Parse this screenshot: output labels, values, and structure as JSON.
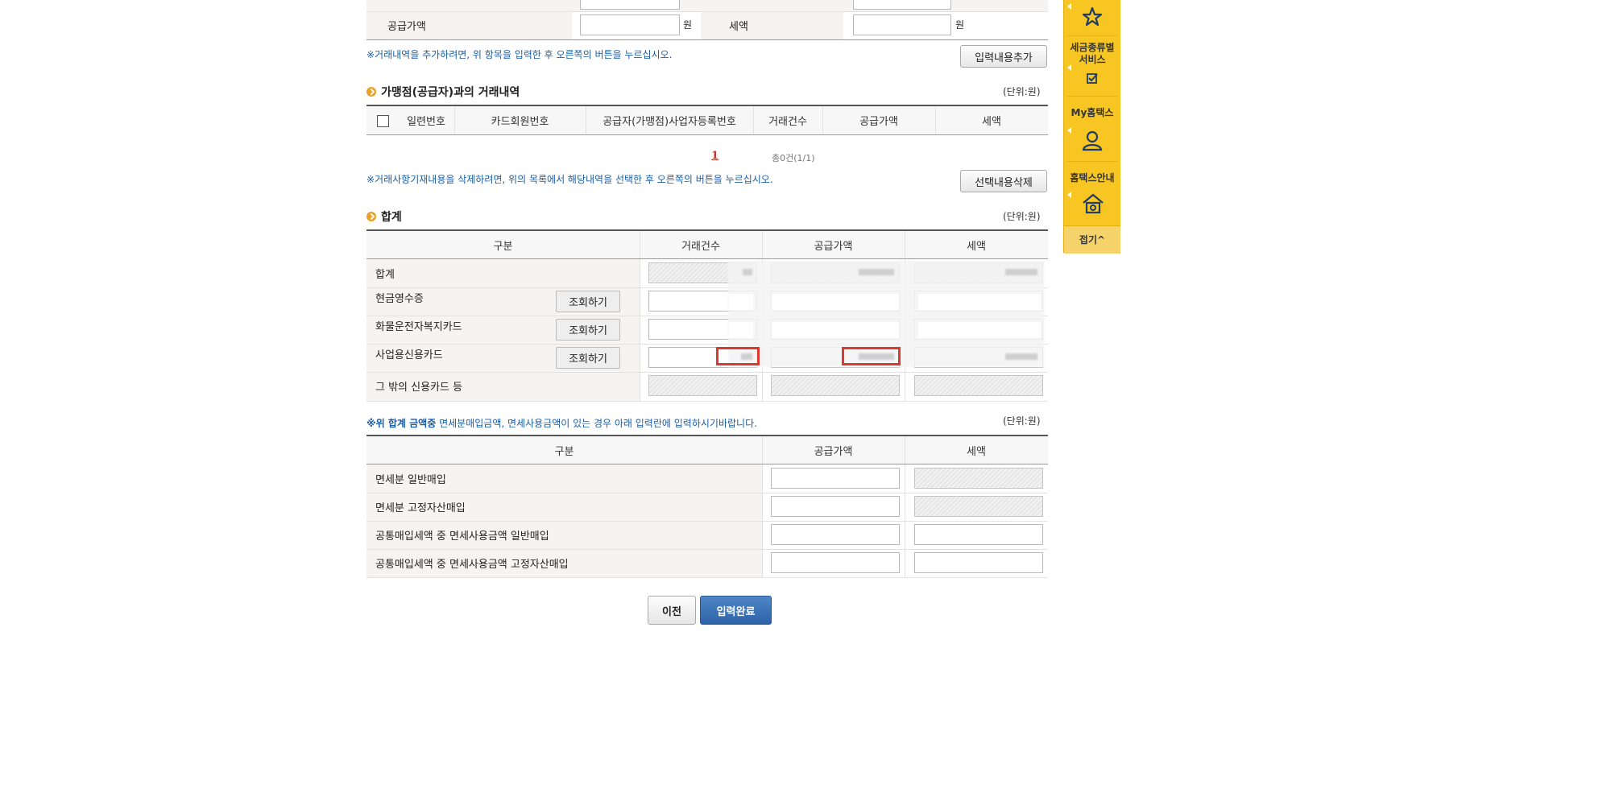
{
  "top": {
    "supply_label": "공급가액",
    "tax_label": "세액",
    "won": "원",
    "add_note": "※거래내역을 추가하려면, 위 항목을 입력한 후 오른쪽의 버튼을 누르십시오.",
    "add_button": "입력내용추가"
  },
  "merchant": {
    "title": "가맹점(공급자)과의 거래내역",
    "unit": "(단위:원)",
    "columns": [
      "일련번호",
      "카드회원번호",
      "공급자(가맹점)사업자등록번호",
      "거래건수",
      "공급가액",
      "세액"
    ],
    "page": "1",
    "total": "총0건(1/1)",
    "delete_note": "※거래사항기재내용을 삭제하려면, 위의 목록에서 해당내역을 선택한 후 오른쪽의 버튼을 누르십시오.",
    "delete_button": "선택내용삭제"
  },
  "summary": {
    "title": "합계",
    "unit": "(단위:원)",
    "columns": [
      "구분",
      "거래건수",
      "공급가액",
      "세액"
    ],
    "rows": [
      {
        "label": "합계"
      },
      {
        "label": "현금영수증",
        "button": "조회하기"
      },
      {
        "label": "화물운전자복지카드",
        "button": "조회하기"
      },
      {
        "label": "사업용신용카드",
        "button": "조회하기"
      },
      {
        "label": "그 밖의 신용카드 등"
      }
    ]
  },
  "exempt": {
    "note_prefix": "※위 합계 금액중",
    "note_rest": " 면세분매입금액, 면세사용금액이 있는 경우 아래 입력란에 입력하시기바랍니다.",
    "unit": "(단위:원)",
    "columns": [
      "구분",
      "공급가액",
      "세액"
    ],
    "rows": [
      {
        "label": "면세분 일반매입"
      },
      {
        "label": "면세분 고정자산매입"
      },
      {
        "label": "공통매입세액 중 면세사용금액 일반매입"
      },
      {
        "label": "공통매입세액 중 면세사용금액 고정자산매입"
      }
    ]
  },
  "footer": {
    "prev_button": "이전",
    "done_button": "입력완료"
  },
  "quickbar": {
    "tax_service_line1": "세금종류별",
    "tax_service_line2": "서비스",
    "my_hometax": "My홈택스",
    "hometax_guide": "홈택스안내",
    "collapse": "접기^"
  },
  "colors": {
    "accent_blue": "#1a5ea6",
    "quickbar_yellow": "#f7c622",
    "highlight_red": "#d83a2f",
    "primary_button": "#2c63a8"
  }
}
